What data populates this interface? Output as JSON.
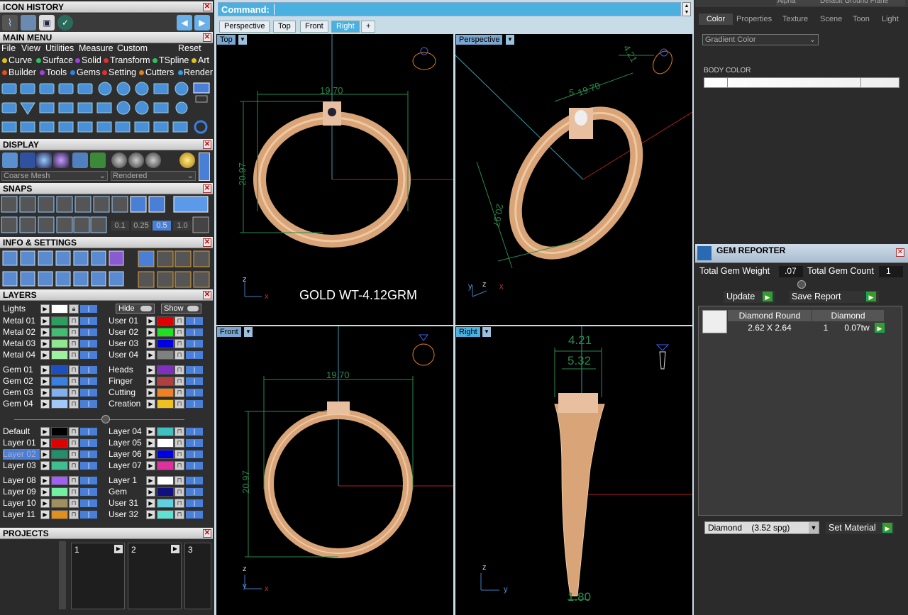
{
  "icon_history": {
    "title": "ICON HISTORY"
  },
  "main_menu": {
    "title": "MAIN MENU",
    "menu": [
      "File",
      "View",
      "Utilities",
      "Measure",
      "Custom"
    ],
    "reset": "Reset",
    "row2": [
      {
        "label": "Curve",
        "color": "#e0c020"
      },
      {
        "label": "Surface",
        "color": "#30c060"
      },
      {
        "label": "Solid",
        "color": "#a040e0"
      },
      {
        "label": "Transform",
        "color": "#e03030"
      },
      {
        "label": "TSpline",
        "color": "#30c060"
      },
      {
        "label": "Art",
        "color": "#e0c020"
      }
    ],
    "row3": [
      {
        "label": "Builder",
        "color": "#e05020"
      },
      {
        "label": "Tools",
        "color": "#a040e0"
      },
      {
        "label": "Gems",
        "color": "#3080e0"
      },
      {
        "label": "Setting",
        "color": "#e03030"
      },
      {
        "label": "Cutters",
        "color": "#e08020"
      },
      {
        "label": "Render",
        "color": "#30a0e0"
      }
    ]
  },
  "display": {
    "title": "DISPLAY",
    "mesh": "Coarse Mesh",
    "mode": "Rendered"
  },
  "snaps": {
    "title": "SNAPS",
    "values": [
      "0.1",
      "0.25",
      "0.5",
      "1.0"
    ]
  },
  "info": {
    "title": "INFO & SETTINGS"
  },
  "layers": {
    "title": "LAYERS",
    "lights": "Lights",
    "hide": "Hide",
    "show": "Show",
    "left": [
      {
        "label": "Metal 01",
        "color": "#2e9e5e"
      },
      {
        "label": "Metal 02",
        "color": "#3fbf6f"
      },
      {
        "label": "Metal 03",
        "color": "#8fe88f"
      },
      {
        "label": "Metal 04",
        "color": "#9ff09f"
      },
      {
        "label": "Gem 01",
        "color": "#1a50c0"
      },
      {
        "label": "Gem 02",
        "color": "#3a80e0"
      },
      {
        "label": "Gem 03",
        "color": "#80b0f0"
      },
      {
        "label": "Gem 04",
        "color": "#a0c8f8"
      },
      {
        "label": "Default",
        "color": "#000000"
      },
      {
        "label": "Layer 01",
        "color": "#e00000"
      },
      {
        "label": "Layer 02",
        "color": "#20906a"
      },
      {
        "label": "Layer 03",
        "color": "#3fbf8f"
      },
      {
        "label": "Layer 08",
        "color": "#a060f0"
      },
      {
        "label": "Layer 09",
        "color": "#70f0a0"
      },
      {
        "label": "Layer 10",
        "color": "#a09060"
      },
      {
        "label": "Layer 11",
        "color": "#e09020"
      }
    ],
    "right": [
      {
        "label": "User 01",
        "color": "#e00000"
      },
      {
        "label": "User 02",
        "color": "#20e020"
      },
      {
        "label": "User 03",
        "color": "#0000e0"
      },
      {
        "label": "User 04",
        "color": "#808080"
      },
      {
        "label": "Heads",
        "color": "#8030c0"
      },
      {
        "label": "Finger",
        "color": "#b04040"
      },
      {
        "label": "Cutting",
        "color": "#f08020"
      },
      {
        "label": "Creation",
        "color": "#f0c020"
      },
      {
        "label": "Layer 04",
        "color": "#40c0c0"
      },
      {
        "label": "Layer 05",
        "color": "#ffffff"
      },
      {
        "label": "Layer 06",
        "color": "#0000e0"
      },
      {
        "label": "Layer 07",
        "color": "#e030a0"
      },
      {
        "label": "Layer 1",
        "color": "#ffffff"
      },
      {
        "label": "Gem",
        "color": "#101080"
      },
      {
        "label": "User 31",
        "color": "#60d0e0"
      },
      {
        "label": "User 32",
        "color": "#60e0d0"
      }
    ]
  },
  "projects": {
    "title": "PROJECTS",
    "slots": [
      "1",
      "2",
      "3"
    ]
  },
  "command": {
    "label": "Command:"
  },
  "viewport_tabs": [
    "Perspective",
    "Top",
    "Front",
    "Right",
    "+"
  ],
  "viewports": {
    "top": {
      "label": "Top",
      "dim_width": "19.70",
      "dim_height": "20.97",
      "caption": "GOLD WT-4.12GRM"
    },
    "perspective": {
      "label": "Perspective",
      "dim_width": "19.70",
      "dim_depth": "4.21",
      "dim_height": "20.97",
      "dim_small": "5"
    },
    "front": {
      "label": "Front",
      "dim_width": "19.70",
      "dim_height": "20.97"
    },
    "right": {
      "label": "Right",
      "dim_top1": "4.21",
      "dim_top2": "5.32",
      "dim_bottom": "1.80"
    }
  },
  "axes": {
    "x": "x",
    "y": "y",
    "z": "z"
  },
  "right_panel": {
    "top_fields": [
      "Alpha",
      "Default Ground Plane"
    ],
    "tabs": [
      "Color",
      "Properties",
      "Texture",
      "Scene",
      "Toon",
      "Light"
    ],
    "gradient": "Gradient Color",
    "body_color": "BODY COLOR"
  },
  "gem_reporter": {
    "title": "GEM REPORTER",
    "total_weight_label": "Total Gem Weight",
    "total_weight": ".07",
    "total_count_label": "Total Gem Count",
    "total_count": "1",
    "update": "Update",
    "save_report": "Save Report",
    "row": {
      "shape": "Diamond Round",
      "material": "Diamond",
      "size": "2.62 X 2.64",
      "count": "1",
      "weight": "0.07tw"
    },
    "material_select": "Diamond    (3.52 spg)",
    "set_material": "Set Material"
  }
}
